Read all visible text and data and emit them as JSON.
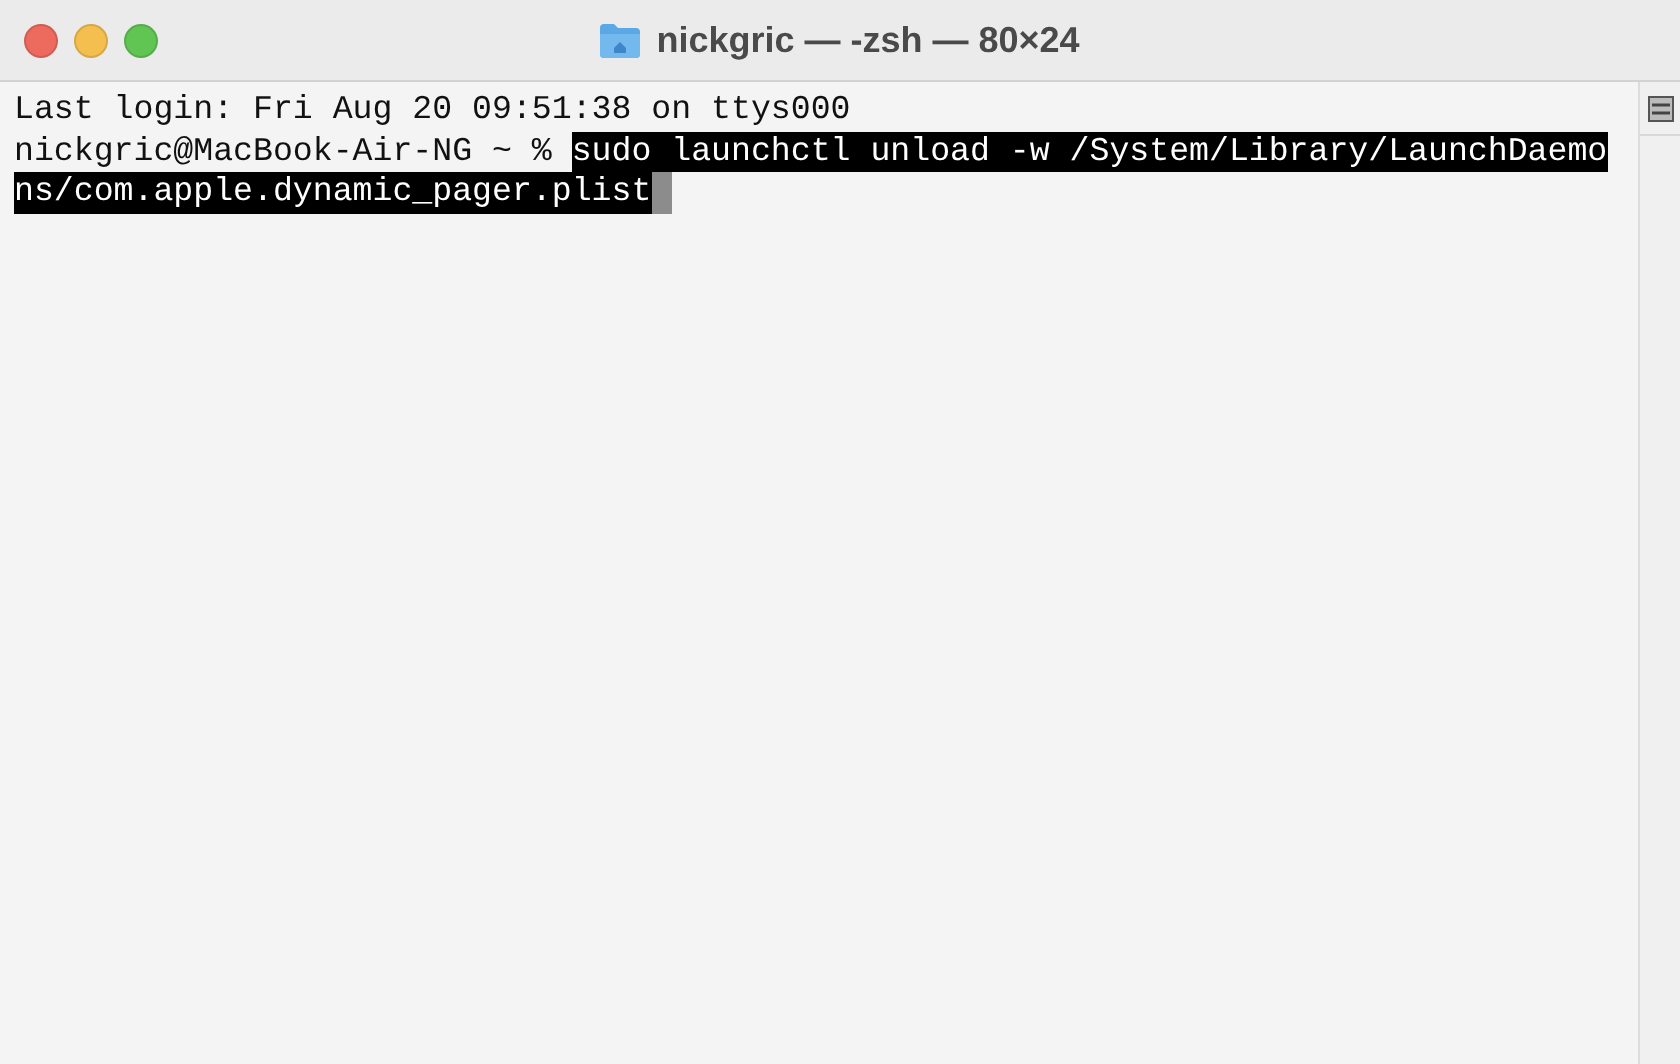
{
  "window": {
    "title": "nickgric — -zsh — 80×24"
  },
  "terminal": {
    "lines": [
      {
        "segments": [
          {
            "text": "Last login: Fri Aug 20 09:51:38 on ttys000",
            "selected": false
          }
        ]
      },
      {
        "segments": [
          {
            "text": "nickgric@MacBook-Air-NG ~ % ",
            "selected": false
          },
          {
            "text": "sudo launchctl unload -w /System/Library/LaunchDaemo",
            "selected": true
          }
        ]
      },
      {
        "segments": [
          {
            "text": "ns/com.apple.dynamic_pager.plist",
            "selected": true
          }
        ],
        "cursor": true
      }
    ]
  }
}
